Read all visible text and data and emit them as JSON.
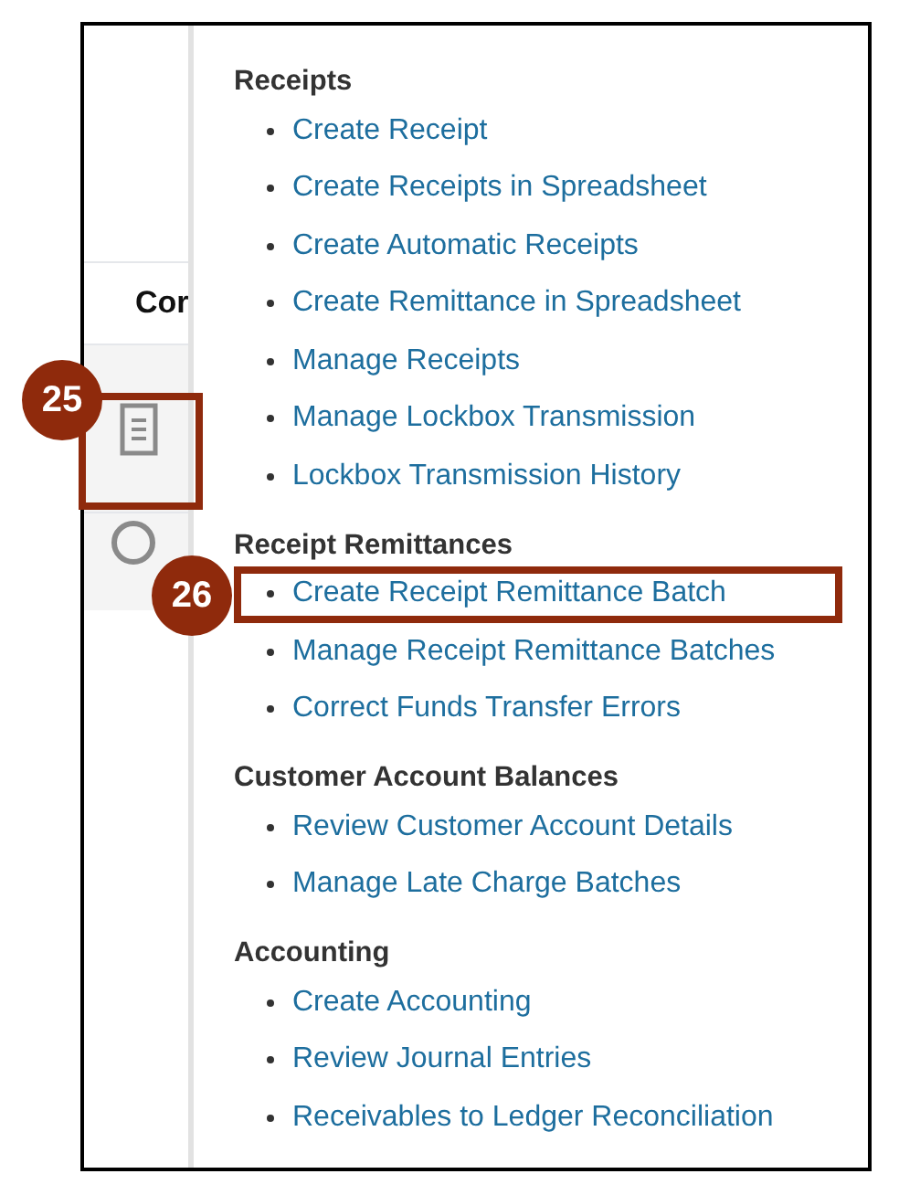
{
  "table": {
    "column_header": "Cor",
    "rows": [
      {
        "kind": "document",
        "callout": "25"
      },
      {
        "kind": "radio",
        "selected": false
      }
    ]
  },
  "sections": [
    {
      "heading": "Receipts",
      "items": [
        {
          "label": "Create Receipt"
        },
        {
          "label": "Create Receipts in Spreadsheet"
        },
        {
          "label": "Create Automatic Receipts"
        },
        {
          "label": "Create Remittance in Spreadsheet"
        },
        {
          "label": "Manage Receipts"
        },
        {
          "label": "Manage Lockbox Transmission"
        },
        {
          "label": "Lockbox Transmission History"
        }
      ]
    },
    {
      "heading": "Receipt Remittances",
      "items": [
        {
          "label": "Create Receipt Remittance Batch",
          "callout": "26"
        },
        {
          "label": "Manage Receipt Remittance Batches"
        },
        {
          "label": "Correct Funds Transfer Errors"
        }
      ]
    },
    {
      "heading": "Customer Account Balances",
      "items": [
        {
          "label": "Review Customer Account Details"
        },
        {
          "label": "Manage Late Charge Batches"
        }
      ]
    },
    {
      "heading": "Accounting",
      "items": [
        {
          "label": "Create Accounting"
        },
        {
          "label": "Review Journal Entries"
        },
        {
          "label": "Receivables to Ledger Reconciliation"
        }
      ]
    }
  ]
}
